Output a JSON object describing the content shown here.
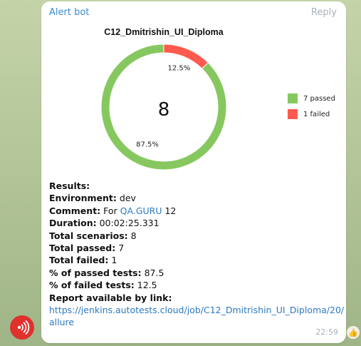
{
  "message": {
    "sender": "Alert bot",
    "reply_label": "Reply",
    "time": "22:59"
  },
  "chart_data": {
    "type": "pie",
    "title": "C12_Dmitrishin_UI_Diploma",
    "center_label": "8",
    "slices": [
      {
        "name": "7 passed",
        "value": 87.5,
        "label": "87.5%",
        "color": "#86c85f"
      },
      {
        "name": "1 failed",
        "value": 12.5,
        "label": "12.5%",
        "color": "#ff5a4e"
      }
    ],
    "legend_position": "right"
  },
  "report": {
    "results_label": "Results:",
    "environment_key": "Environment:",
    "environment_val": "dev",
    "comment_key": "Comment:",
    "comment_pre": "For",
    "comment_link": "QA.GURU",
    "comment_post": "12",
    "duration_key": "Duration:",
    "duration_val": "00:02:25.331",
    "scenarios_key": "Total scenarios:",
    "scenarios_val": "8",
    "passed_key": "Total passed:",
    "passed_val": "7",
    "failed_key": "Total failed:",
    "failed_val": "1",
    "pct_passed_key": "% of passed tests:",
    "pct_passed_val": "87.5",
    "pct_failed_key": "% of failed tests:",
    "pct_failed_val": "12.5",
    "link_label": "Report available by link:",
    "link_line1": "https://jenkins.autotests.cloud/job/C12_Dmitrishin_UI_Diploma/20/",
    "link_line2": "allure"
  },
  "reaction": "👍",
  "colors": {
    "link": "#2c7ac1",
    "sender": "#3a8bd0",
    "passed": "#86c85f",
    "failed": "#ff5a4e"
  }
}
